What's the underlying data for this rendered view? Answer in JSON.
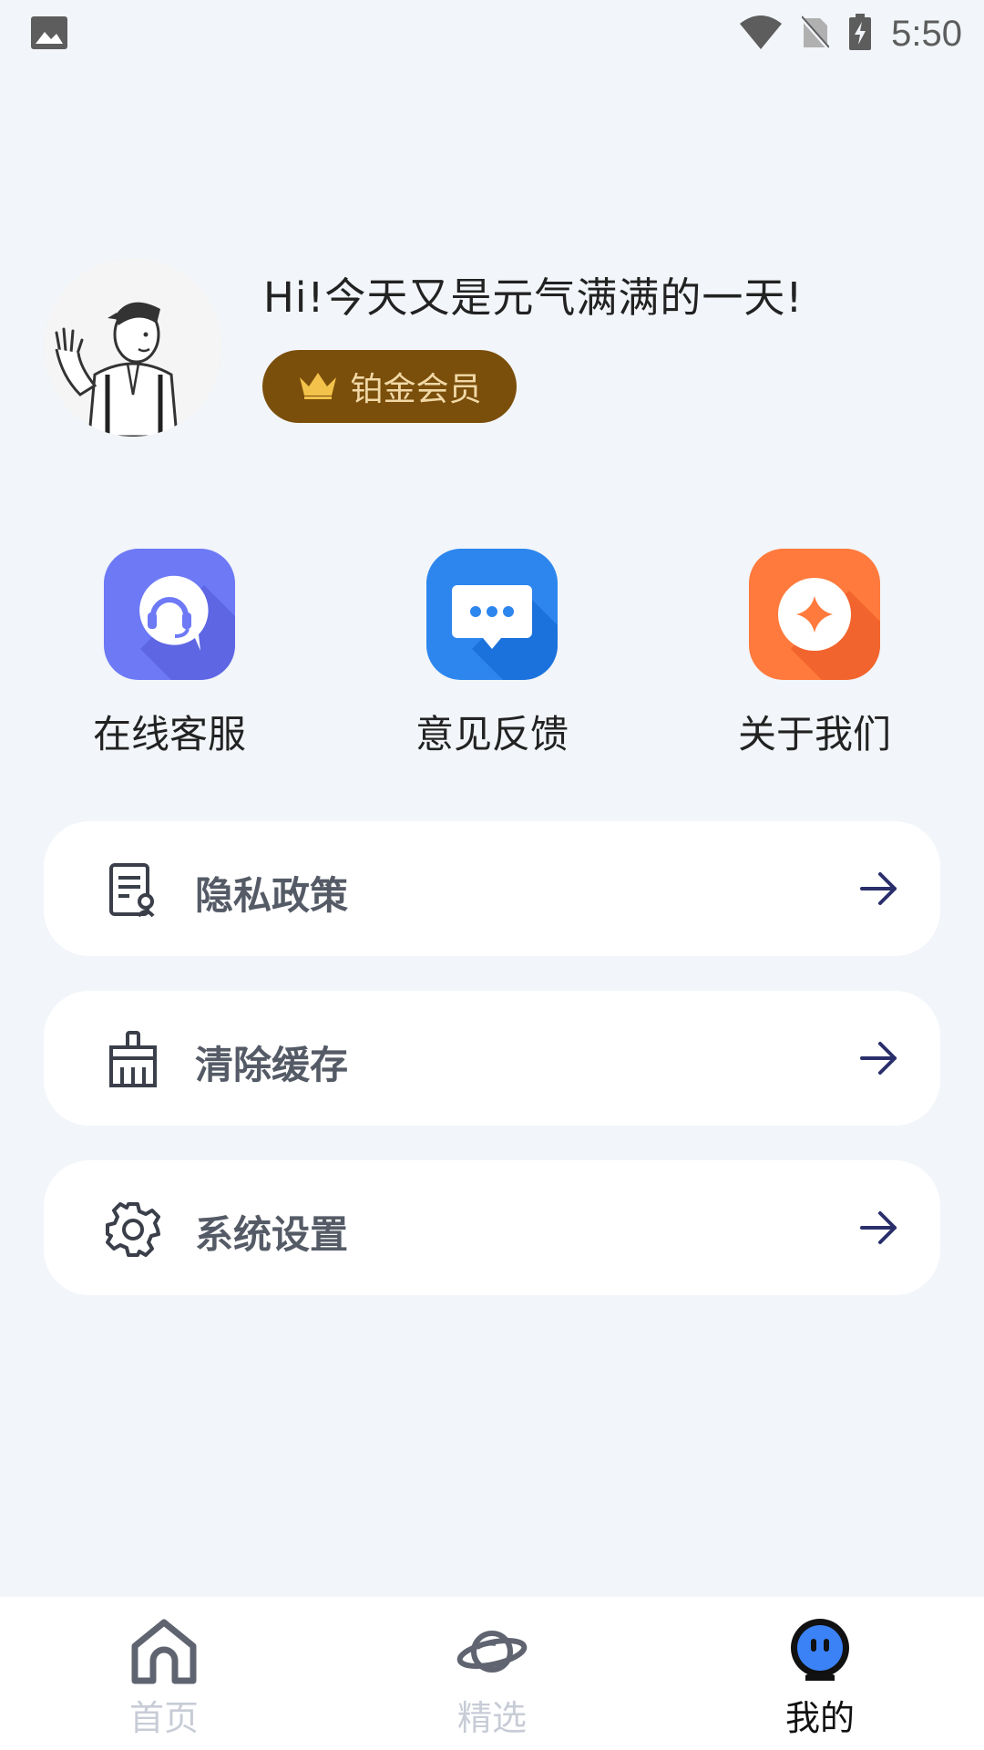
{
  "status_bar": {
    "time": "5:50",
    "icons": [
      "gallery-icon",
      "wifi-icon",
      "no-sim-icon",
      "battery-charging-icon"
    ]
  },
  "profile": {
    "greeting": "Hi!今天又是元气满满的一天!",
    "badge_label": "铂金会员",
    "badge_icon": "crown-icon"
  },
  "shortcuts": [
    {
      "label": "在线客服",
      "icon": "customer-service-icon",
      "color": "#6d79f5"
    },
    {
      "label": "意见反馈",
      "icon": "feedback-chat-icon",
      "color": "#2d86ee"
    },
    {
      "label": "关于我们",
      "icon": "about-diamond-icon",
      "color": "#ff7a3c"
    }
  ],
  "menu": [
    {
      "label": "隐私政策",
      "icon": "privacy-document-icon"
    },
    {
      "label": "清除缓存",
      "icon": "broom-icon"
    },
    {
      "label": "系统设置",
      "icon": "gear-icon"
    }
  ],
  "tab_bar": {
    "tabs": [
      {
        "label": "首页",
        "icon": "home-icon",
        "active": false
      },
      {
        "label": "精选",
        "icon": "planet-icon",
        "active": false
      },
      {
        "label": "我的",
        "icon": "mine-robot-icon",
        "active": true
      }
    ]
  }
}
